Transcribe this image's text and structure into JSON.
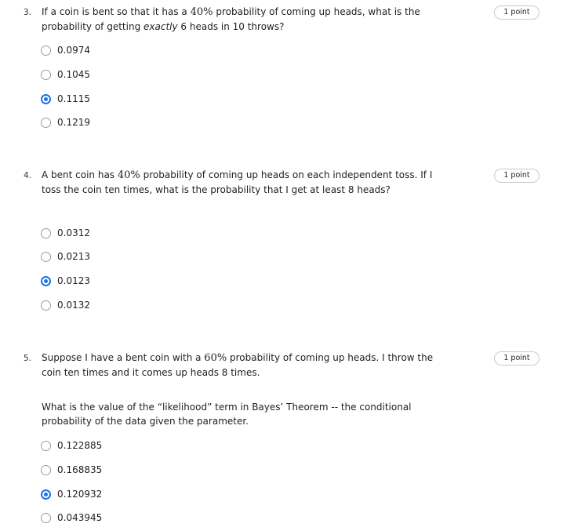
{
  "questions": [
    {
      "number": "3.",
      "text_before": "If a coin is bent so that it has a ",
      "math": "40%",
      "text_after": " probability of coming up heads, what is the probability of getting ",
      "emph": "exactly",
      "text_end": " 6 heads in 10 throws?",
      "points": "1 point",
      "options": [
        "0.0974",
        "0.1045",
        "0.1115",
        "0.1219"
      ],
      "selected": 2
    },
    {
      "number": "4.",
      "text_before": "A bent coin has ",
      "math": "40%",
      "text_after": " probability of coming up heads on each independent toss. If I toss the coin ten times, what is the probability that I get at least 8 heads?",
      "points": "1 point",
      "options": [
        "0.0312",
        "0.0213",
        "0.0123",
        "0.0132"
      ],
      "selected": 2
    },
    {
      "number": "5.",
      "text_before": "Suppose I have a bent coin with a ",
      "math": "60%",
      "text_after": " probability of coming up heads. I throw the coin ten times and it comes up heads 8 times.",
      "subtext": "What is the value of the “likelihood” term in Bayes’ Theorem -- the conditional probability of the data given the parameter.",
      "points": "1 point",
      "options": [
        "0.122885",
        "0.168835",
        "0.120932",
        "0.043945"
      ],
      "selected": 2
    }
  ],
  "colors": {
    "accent": "#1a73e8",
    "radio_border": "#9a9a9a"
  }
}
